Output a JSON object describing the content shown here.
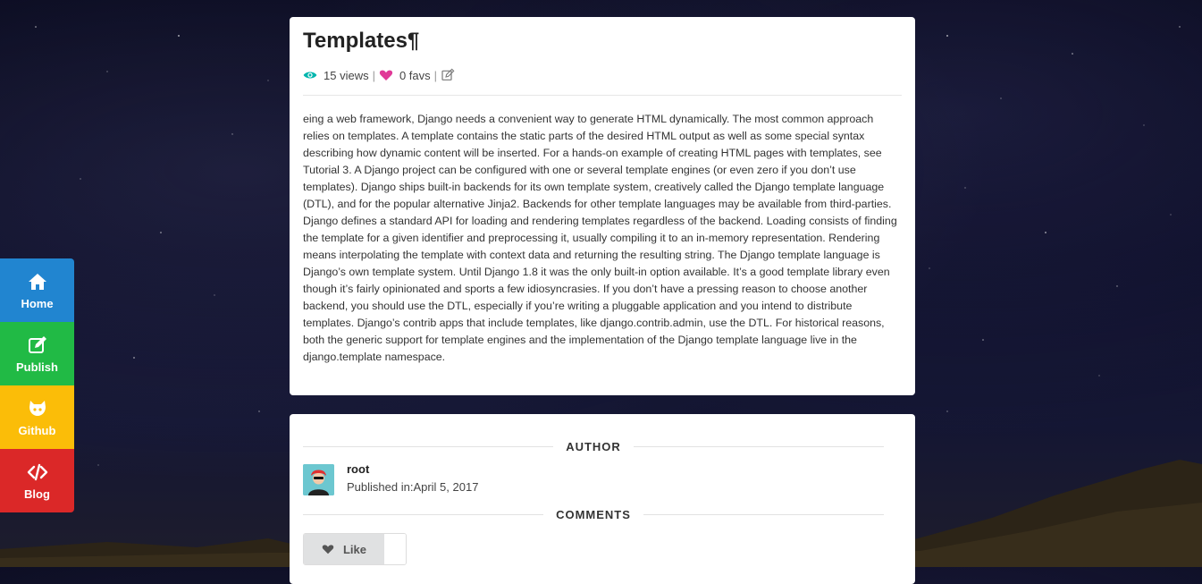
{
  "sidebar": {
    "items": [
      {
        "label": "Home",
        "icon": "home-icon",
        "color": "#2185d0"
      },
      {
        "label": "Publish",
        "icon": "edit-icon",
        "color": "#21ba45"
      },
      {
        "label": "Github",
        "icon": "github-icon",
        "color": "#fbbd08"
      },
      {
        "label": "Blog",
        "icon": "code-icon",
        "color": "#db2828"
      }
    ]
  },
  "article": {
    "title": "Templates¶",
    "views": "15 views",
    "favs": "0 favs",
    "separator": "|",
    "body": "eing a web framework, Django needs a convenient way to generate HTML dynamically. The most common approach relies on templates. A template contains the static parts of the desired HTML output as well as some special syntax describing how dynamic content will be inserted. For a hands-on example of creating HTML pages with templates, see Tutorial 3. A Django project can be configured with one or several template engines (or even zero if you don’t use templates). Django ships built-in backends for its own template system, creatively called the Django template language (DTL), and for the popular alternative Jinja2. Backends for other template languages may be available from third-parties. Django defines a standard API for loading and rendering templates regardless of the backend. Loading consists of finding the template for a given identifier and preprocessing it, usually compiling it to an in-memory representation. Rendering means interpolating the template with context data and returning the resulting string. The Django template language is Django’s own template system. Until Django 1.8 it was the only built-in option available. It’s a good template library even though it’s fairly opinionated and sports a few idiosyncrasies. If you don’t have a pressing reason to choose another backend, you should use the DTL, especially if you’re writing a pluggable application and you intend to distribute templates. Django’s contrib apps that include templates, like django.contrib.admin, use the DTL. For historical reasons, both the generic support for template engines and the implementation of the Django template language live in the django.template namespace."
  },
  "author_section": {
    "heading": "AUTHOR",
    "name": "root",
    "published": "Published in:April 5, 2017"
  },
  "comments_section": {
    "heading": "COMMENTS",
    "like_label": "Like"
  },
  "colors": {
    "views_icon": "#00b5ad",
    "favs_icon": "#e03997"
  }
}
